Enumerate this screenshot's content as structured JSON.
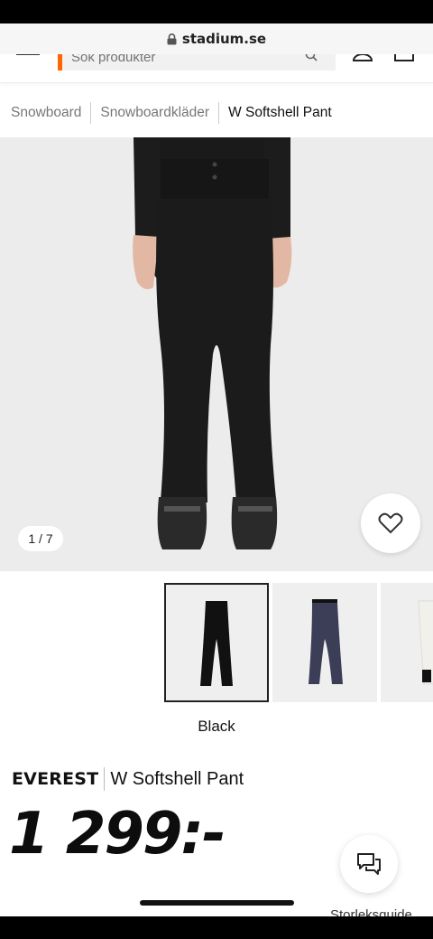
{
  "browser": {
    "url": "stadium.se"
  },
  "header": {
    "search_placeholder": "Sök produkter"
  },
  "breadcrumb": [
    "Snowboard",
    "Snowboardkläder",
    "W Softshell Pant"
  ],
  "gallery": {
    "counter": "1 / 7"
  },
  "variants": [
    {
      "color": "#111111",
      "selected": true
    },
    {
      "color": "#3c3d56",
      "selected": false
    },
    {
      "color": "#f2f0ea",
      "selected": false
    }
  ],
  "selected_color": "Black",
  "product": {
    "brand": "EVEREST",
    "name": "W Softshell Pant",
    "price": "1 299:-"
  },
  "footer": {
    "size_guide": "Storleksguide"
  },
  "colors": {
    "accent": "#ff6600",
    "gallery_bg": "#ececec"
  },
  "icons": [
    "lock-icon",
    "menu-icon",
    "search-icon",
    "user-icon",
    "cart-icon",
    "heart-icon",
    "chat-icon"
  ]
}
